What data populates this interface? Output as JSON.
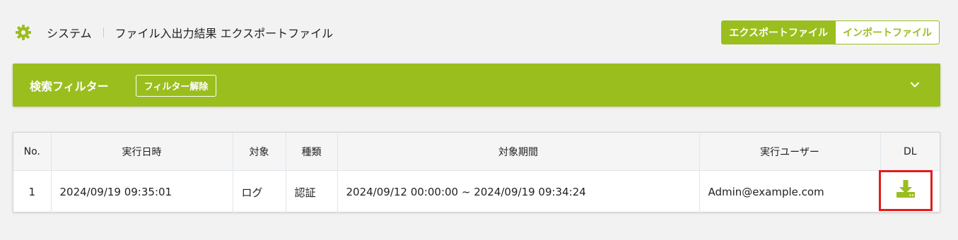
{
  "header": {
    "breadcrumb_root": "システム",
    "breadcrumb_page": "ファイル入出力結果 エクスポートファイル",
    "icon": "gear-icon",
    "toggle": {
      "export_label": "エクスポートファイル",
      "import_label": "インポートファイル",
      "selected": "エクスポートファイル"
    }
  },
  "filter": {
    "title": "検索フィルター",
    "clear_label": "フィルター解除",
    "expand_icon": "chevron-down-icon"
  },
  "table": {
    "columns": [
      "No.",
      "実行日時",
      "対象",
      "種類",
      "対象期間",
      "実行ユーザー",
      "DL"
    ],
    "rows": [
      {
        "no": "1",
        "executed_at": "2024/09/19 09:35:01",
        "target": "ログ",
        "kind": "認証",
        "period": "2024/09/12 00:00:00 ~ 2024/09/19 09:34:24",
        "user": "Admin@example.com",
        "dl_icon": "download-icon"
      }
    ]
  },
  "colors": {
    "accent": "#9bbe1f",
    "highlight": "#e11c1c",
    "background": "#f2f2f2"
  }
}
